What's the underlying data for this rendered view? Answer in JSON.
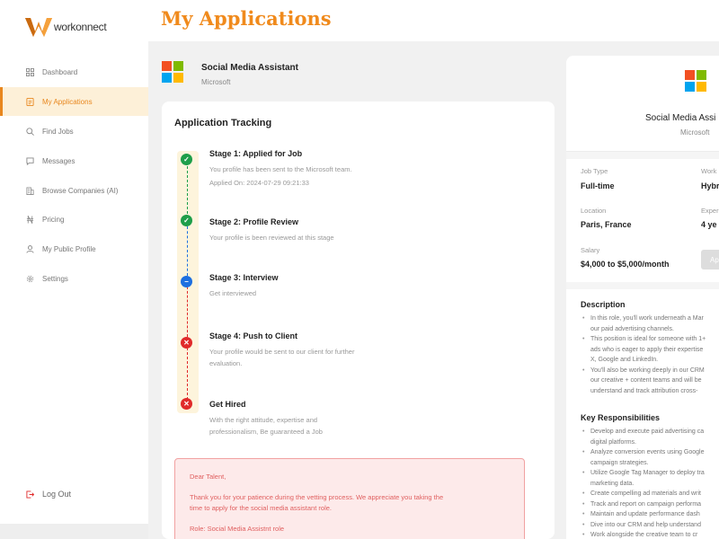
{
  "app": {
    "logo_text": "workonnect"
  },
  "header": {
    "title": "My Applications"
  },
  "sidebar": {
    "items": [
      {
        "label": "Dashboard",
        "icon": "grid-icon"
      },
      {
        "label": "My Applications",
        "icon": "document-icon",
        "active": true
      },
      {
        "label": "Find Jobs",
        "icon": "search-icon"
      },
      {
        "label": "Messages",
        "icon": "message-icon"
      },
      {
        "label": "Browse Companies (AI)",
        "icon": "building-icon"
      },
      {
        "label": "Pricing",
        "icon": "naira-icon"
      },
      {
        "label": "My Public Profile",
        "icon": "user-icon"
      },
      {
        "label": "Settings",
        "icon": "gear-icon"
      }
    ],
    "logout": {
      "label": "Log Out",
      "icon": "logout-icon"
    }
  },
  "job": {
    "title": "Social Media Assistant",
    "company": "Microsoft"
  },
  "tracking": {
    "title": "Application Tracking",
    "stages": [
      {
        "title": "Stage 1: Applied for Job",
        "desc1": "You profile has been sent to the Microsoft team.",
        "desc2": "Applied On: 2024-07-29 09:21:33",
        "status": "complete"
      },
      {
        "title": "Stage 2: Profile Review",
        "desc1": "Your profile is been reviewed at this stage",
        "status": "complete"
      },
      {
        "title": "Stage 3: Interview",
        "desc1": "Get interviewed",
        "status": "in-progress"
      },
      {
        "title": "Stage 4: Push to Client",
        "desc1": "Your profile would be sent to our client for further",
        "desc2": "evaluation.",
        "status": "pending"
      },
      {
        "title": "Get Hired",
        "desc1": "With the right attitude, expertise and",
        "desc2": "professionalism, Be guaranteed a Job",
        "status": "pending"
      }
    ],
    "message": {
      "greeting": "Dear Talent,",
      "line1": "Thank you for your patience during the vetting process. We appreciate you taking the",
      "line2": "time to apply for the social media assistant role.",
      "role": "Role: Social Media Assistnt role"
    }
  },
  "details": {
    "title": "Social Media Assi",
    "company": "Microsoft",
    "job_type_label": "Job Type",
    "job_type_value": "Full-time",
    "work_label": "Work",
    "work_value": "Hybr",
    "location_label": "Location",
    "location_value": "Paris, France",
    "exp_label": "Exper",
    "exp_value": "4 ye",
    "salary_label": "Salary",
    "salary_value": "$4,000 to $5,000/month",
    "apply_label": "Ap",
    "description_title": "Description",
    "description": [
      [
        "In this role, you'll work underneath a Mar",
        "our paid advertising channels."
      ],
      [
        "This position is ideal for someone with 1+",
        "ads who is eager to apply their expertise",
        "X, Google and LinkedIn."
      ],
      [
        "You'll also be working deeply in our CRM",
        "our creative + content teams and will be",
        "understand and track attribution cross-"
      ]
    ],
    "responsibilities_title": "Key Responsibilities",
    "responsibilities": [
      [
        "Develop and execute paid advertising ca",
        "digital platforms."
      ],
      [
        "Analyze conversion events using Google",
        "campaign strategies."
      ],
      [
        "Utilize Google Tag Manager to deploy tra",
        "marketing data."
      ],
      [
        "Create compelling ad materials and writ"
      ],
      [
        "Track and report on campaign performa"
      ],
      [
        "Maintain and update performance dash"
      ],
      [
        "Dive into our CRM and help understand"
      ],
      [
        "Work alongside the creative team to cr"
      ]
    ]
  },
  "colors": {
    "accent": "#f08a1c",
    "success": "#1e9e4a",
    "info": "#1d6fe0",
    "danger": "#e02a2a"
  }
}
